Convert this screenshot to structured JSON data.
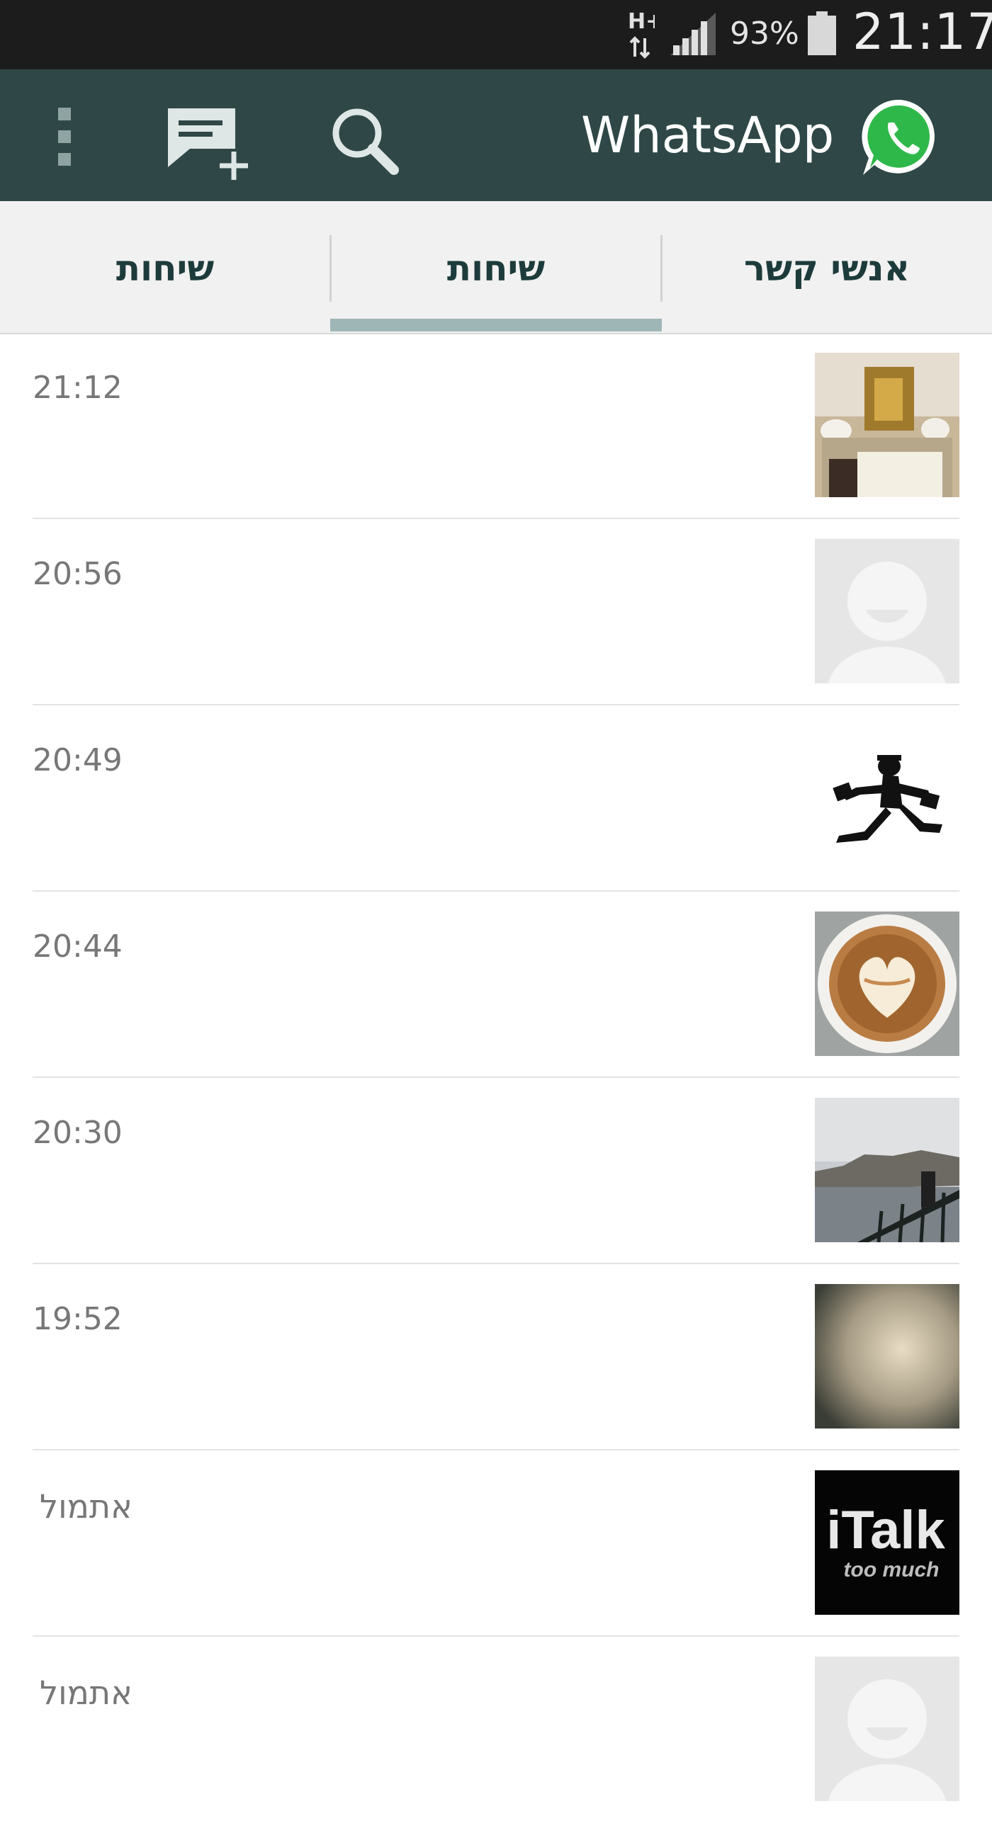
{
  "status_bar": {
    "network": "H+",
    "battery_percent": "93%",
    "clock": "21:17",
    "icons": [
      "network-arrows-icon",
      "signal-icon",
      "battery-icon"
    ]
  },
  "app_bar": {
    "title": "WhatsApp",
    "actions": [
      "overflow-menu-icon",
      "new-chat-icon",
      "search-icon"
    ],
    "logo": "whatsapp-logo-icon",
    "colors": {
      "background": "#2f4747",
      "logo": "#2fb84a"
    }
  },
  "tabs": [
    {
      "label": "שיחות",
      "selected": false
    },
    {
      "label": "שיחות",
      "selected": true
    },
    {
      "label": "אנשי קשר",
      "selected": false
    }
  ],
  "chats": [
    {
      "time": "21:12",
      "avatar": "church-photo"
    },
    {
      "time": "20:56",
      "avatar": "default-contact-icon"
    },
    {
      "time": "20:49",
      "avatar": "running-figure-drawing"
    },
    {
      "time": "20:44",
      "avatar": "latte-art-photo"
    },
    {
      "time": "20:30",
      "avatar": "river-city-photo"
    },
    {
      "time": "19:52",
      "avatar": "blurred-gradient-photo"
    },
    {
      "time": "אתמול",
      "avatar": "italk-logo"
    },
    {
      "time": "אתמול",
      "avatar": "default-contact-icon"
    }
  ],
  "avatar_text": {
    "italk_main": "iTalk",
    "italk_sub": "too much"
  }
}
